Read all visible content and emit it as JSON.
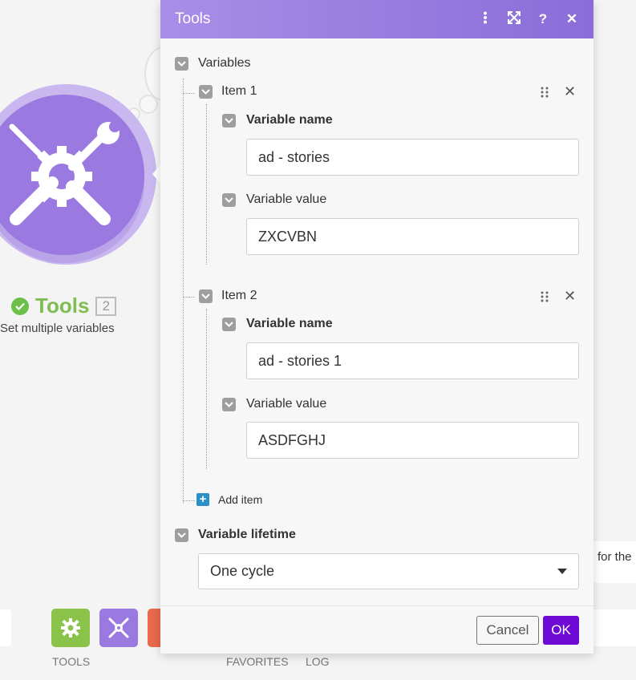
{
  "dialog": {
    "title": "Tools",
    "header_icons": [
      "more-vertical-icon",
      "expand-icon",
      "help-icon",
      "close-icon"
    ],
    "variables_label": "Variables",
    "items": [
      {
        "label": "Item 1",
        "name_label": "Variable name",
        "name_value": "ad - stories",
        "value_label": "Variable value",
        "value_value": "ZXCVBN"
      },
      {
        "label": "Item 2",
        "name_label": "Variable name",
        "name_value": "ad - stories 1",
        "value_label": "Variable value",
        "value_value": "ASDFGHJ"
      }
    ],
    "add_item_label": "Add item",
    "lifetime_label": "Variable lifetime",
    "lifetime_value": "One cycle",
    "cancel_label": "Cancel",
    "ok_label": "OK"
  },
  "module": {
    "name": "Tools",
    "count": "2",
    "subtitle": "Set multiple variables"
  },
  "background": {
    "partial_text": "for the"
  },
  "toolbar": {
    "tools_label": "TOOLS",
    "favorites_label": "FAVORITES",
    "log_label": "LOG"
  },
  "colors": {
    "header_start": "#a98ee8",
    "header_end": "#8a6dd8",
    "ok_button": "#6e0ad3",
    "module_purple": "#9a7ae0",
    "success_green": "#7fbc51",
    "tools_green": "#8bc34a",
    "add_blue": "#2b8fc9"
  }
}
